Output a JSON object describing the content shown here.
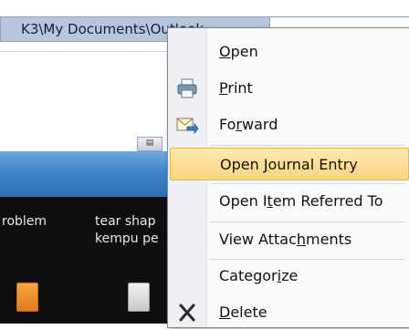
{
  "address_bar": {
    "path": "K3\\My Documents\\Outlook"
  },
  "background": {
    "button_label": "▤",
    "row_text_1": "roblem",
    "row_text_2": "tear shap",
    "row_text_3": "kempu pe"
  },
  "menu": {
    "items": [
      {
        "pre": "",
        "ul": "O",
        "post": "pen",
        "icon": "none"
      },
      {
        "pre": "",
        "ul": "P",
        "post": "rint",
        "icon": "printer-icon"
      },
      {
        "pre": "Fo",
        "ul": "r",
        "post": "ward",
        "icon": "forward-icon"
      },
      {
        "pre": "Open ",
        "ul": "J",
        "post": "ournal Entry",
        "icon": "none"
      },
      {
        "pre": "Open I",
        "ul": "t",
        "post": "em Referred To",
        "icon": "none"
      },
      {
        "pre": "View Attac",
        "ul": "h",
        "post": "ments",
        "icon": "none"
      },
      {
        "pre": "Categor",
        "ul": "i",
        "post": "ze",
        "icon": "none"
      },
      {
        "pre": "",
        "ul": "D",
        "post": "elete",
        "icon": "delete-x-icon"
      }
    ]
  },
  "colors": {
    "highlight": "#f9d680",
    "address_bg": "#b7c6db",
    "band_blue": "#3d85c6"
  }
}
